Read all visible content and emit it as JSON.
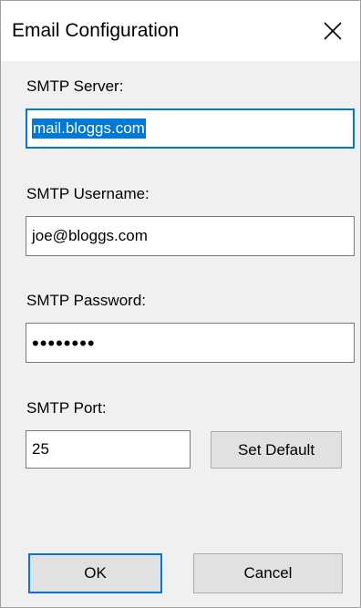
{
  "window": {
    "title": "Email Configuration"
  },
  "icons": {
    "close": "close-icon"
  },
  "form": {
    "server_label": "SMTP Server:",
    "server_value": "mail.bloggs.com",
    "username_label": "SMTP Username:",
    "username_value": "joe@bloggs.com",
    "password_label": "SMTP Password:",
    "password_masked": "••••••••",
    "port_label": "SMTP Port:",
    "port_value": "25"
  },
  "buttons": {
    "set_default": "Set Default",
    "ok": "OK",
    "cancel": "Cancel"
  },
  "colors": {
    "accent": "#0078d7",
    "dialog_background": "#f0f0f0",
    "button_face": "#e1e1e1"
  }
}
